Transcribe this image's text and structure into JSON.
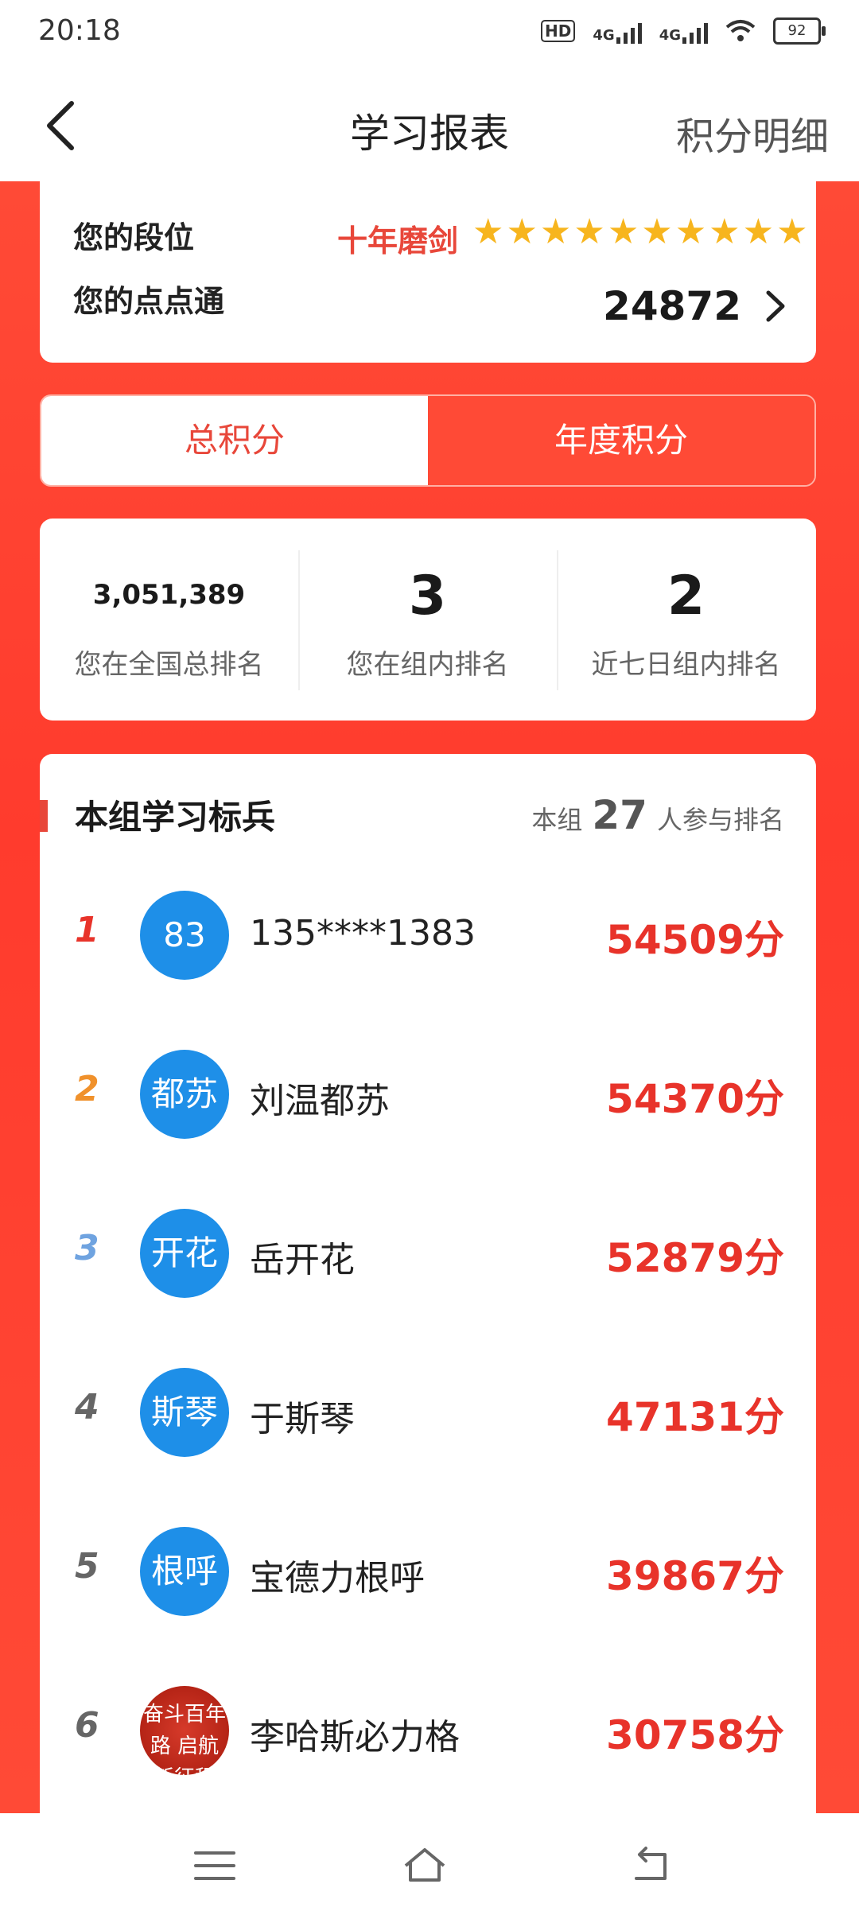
{
  "status_bar": {
    "time": "20:18",
    "network": "4G",
    "hd": "HD",
    "battery": "92"
  },
  "header": {
    "title": "学习报表",
    "right_link": "积分明细"
  },
  "rank_card": {
    "level_label": "您的段位",
    "level_name": "十年磨剑",
    "stars": 10,
    "ddt_label": "您的点点通",
    "ddt_value": "24872"
  },
  "tabs": [
    {
      "label": "总积分",
      "selected": false
    },
    {
      "label": "年度积分",
      "selected": true
    }
  ],
  "stats": [
    {
      "value": "3,051,389",
      "label": "您在全国总排名"
    },
    {
      "value": "3",
      "label": "您在组内排名"
    },
    {
      "value": "2",
      "label": "近七日组内排名"
    }
  ],
  "group": {
    "title": "本组学习标兵",
    "participants_prefix": "本组",
    "participants_count": "27",
    "participants_suffix": "人参与排名"
  },
  "ranking": [
    {
      "rank": "1",
      "avatar": "83",
      "name": "135****1383",
      "score": "54509分",
      "rank_color": "#e8332a"
    },
    {
      "rank": "2",
      "avatar": "都苏",
      "name": "刘温都苏",
      "score": "54370分",
      "rank_color": "#f0912b"
    },
    {
      "rank": "3",
      "avatar": "开花",
      "name": "岳开花",
      "score": "52879分",
      "rank_color": "#6fa3e0"
    },
    {
      "rank": "4",
      "avatar": "斯琴",
      "name": "于斯琴",
      "score": "47131分",
      "rank_color": "#666666"
    },
    {
      "rank": "5",
      "avatar": "根呼",
      "name": "宝德力根呼",
      "score": "39867分",
      "rank_color": "#666666"
    },
    {
      "rank": "6",
      "avatar": "",
      "avatar_image_text": "奋斗百年路 启航新征程",
      "name": "李哈斯必力格",
      "score": "30758分",
      "rank_color": "#666666"
    }
  ],
  "colors": {
    "accent": "#e8473a",
    "background_red": "#ff4a36",
    "avatar_blue": "#1e8fe8"
  }
}
